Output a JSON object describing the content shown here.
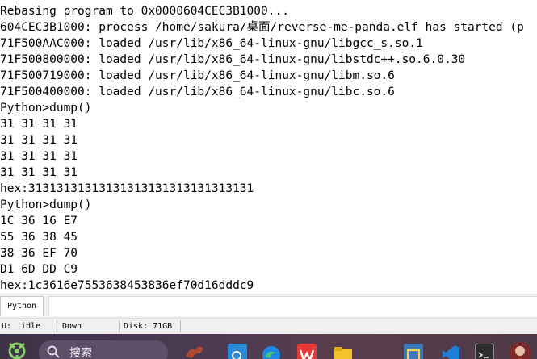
{
  "console": {
    "lines": [
      "Rebasing program to 0x0000604CEC3B1000...",
      "604CEC3B1000: process /home/sakura/桌面/reverse-me-panda.elf has started (p",
      "71F500AAC000: loaded /usr/lib/x86_64-linux-gnu/libgcc_s.so.1",
      "71F500800000: loaded /usr/lib/x86_64-linux-gnu/libstdc++.so.6.0.30",
      "71F500719000: loaded /usr/lib/x86_64-linux-gnu/libm.so.6",
      "71F500400000: loaded /usr/lib/x86_64-linux-gnu/libc.so.6",
      "Python>dump()",
      "31 31 31 31",
      "31 31 31 31",
      "31 31 31 31",
      "31 31 31 31",
      "hex:31313131313131313131313131313131",
      "Python>dump()",
      "1C 36 16 E7",
      "55 36 38 45",
      "38 36 EF 70",
      "D1 6D DD C9",
      "hex:1c3616e7553638453836ef70d16dddc9"
    ]
  },
  "tabs": {
    "active_label": "Python"
  },
  "statusbar": {
    "state": "U:  idle",
    "direction": "Down",
    "disk": "Disk: 71GB"
  },
  "taskbar": {
    "search_label": "搜索",
    "icons": [
      "search-app-icon",
      "edge-icon",
      "wps-icon",
      "file-explorer-icon",
      "python-app-icon",
      "vscode-icon",
      "terminal-icon",
      "user-avatar-icon"
    ]
  },
  "colors": {
    "console_text": "#000000",
    "console_bg": "#ffffff",
    "taskbar_bg": "#4a3a52",
    "edge_blue": "#1e88e5",
    "wps_red": "#e53935",
    "folder_yellow": "#f4c22b",
    "vscode_blue": "#1f7fd6"
  }
}
